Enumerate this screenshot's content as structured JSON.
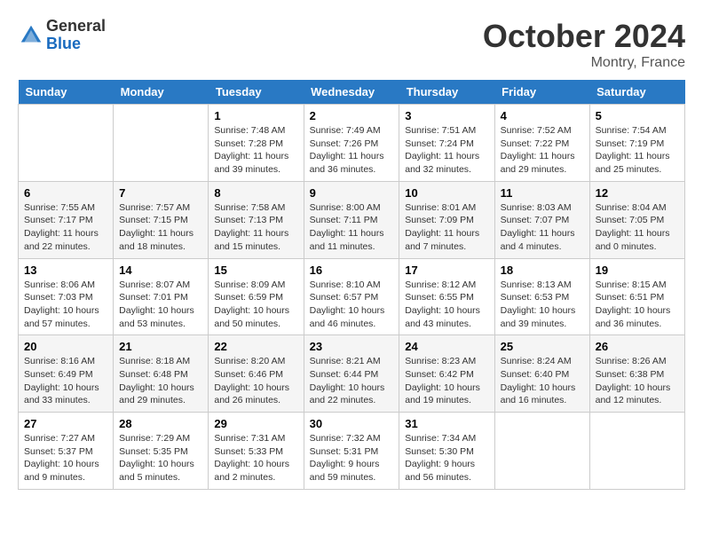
{
  "header": {
    "logo_general": "General",
    "logo_blue": "Blue",
    "month_title": "October 2024",
    "location": "Montry, France"
  },
  "weekdays": [
    "Sunday",
    "Monday",
    "Tuesday",
    "Wednesday",
    "Thursday",
    "Friday",
    "Saturday"
  ],
  "weeks": [
    [
      {
        "day": "",
        "info": ""
      },
      {
        "day": "",
        "info": ""
      },
      {
        "day": "1",
        "info": "Sunrise: 7:48 AM\nSunset: 7:28 PM\nDaylight: 11 hours and 39 minutes."
      },
      {
        "day": "2",
        "info": "Sunrise: 7:49 AM\nSunset: 7:26 PM\nDaylight: 11 hours and 36 minutes."
      },
      {
        "day": "3",
        "info": "Sunrise: 7:51 AM\nSunset: 7:24 PM\nDaylight: 11 hours and 32 minutes."
      },
      {
        "day": "4",
        "info": "Sunrise: 7:52 AM\nSunset: 7:22 PM\nDaylight: 11 hours and 29 minutes."
      },
      {
        "day": "5",
        "info": "Sunrise: 7:54 AM\nSunset: 7:19 PM\nDaylight: 11 hours and 25 minutes."
      }
    ],
    [
      {
        "day": "6",
        "info": "Sunrise: 7:55 AM\nSunset: 7:17 PM\nDaylight: 11 hours and 22 minutes."
      },
      {
        "day": "7",
        "info": "Sunrise: 7:57 AM\nSunset: 7:15 PM\nDaylight: 11 hours and 18 minutes."
      },
      {
        "day": "8",
        "info": "Sunrise: 7:58 AM\nSunset: 7:13 PM\nDaylight: 11 hours and 15 minutes."
      },
      {
        "day": "9",
        "info": "Sunrise: 8:00 AM\nSunset: 7:11 PM\nDaylight: 11 hours and 11 minutes."
      },
      {
        "day": "10",
        "info": "Sunrise: 8:01 AM\nSunset: 7:09 PM\nDaylight: 11 hours and 7 minutes."
      },
      {
        "day": "11",
        "info": "Sunrise: 8:03 AM\nSunset: 7:07 PM\nDaylight: 11 hours and 4 minutes."
      },
      {
        "day": "12",
        "info": "Sunrise: 8:04 AM\nSunset: 7:05 PM\nDaylight: 11 hours and 0 minutes."
      }
    ],
    [
      {
        "day": "13",
        "info": "Sunrise: 8:06 AM\nSunset: 7:03 PM\nDaylight: 10 hours and 57 minutes."
      },
      {
        "day": "14",
        "info": "Sunrise: 8:07 AM\nSunset: 7:01 PM\nDaylight: 10 hours and 53 minutes."
      },
      {
        "day": "15",
        "info": "Sunrise: 8:09 AM\nSunset: 6:59 PM\nDaylight: 10 hours and 50 minutes."
      },
      {
        "day": "16",
        "info": "Sunrise: 8:10 AM\nSunset: 6:57 PM\nDaylight: 10 hours and 46 minutes."
      },
      {
        "day": "17",
        "info": "Sunrise: 8:12 AM\nSunset: 6:55 PM\nDaylight: 10 hours and 43 minutes."
      },
      {
        "day": "18",
        "info": "Sunrise: 8:13 AM\nSunset: 6:53 PM\nDaylight: 10 hours and 39 minutes."
      },
      {
        "day": "19",
        "info": "Sunrise: 8:15 AM\nSunset: 6:51 PM\nDaylight: 10 hours and 36 minutes."
      }
    ],
    [
      {
        "day": "20",
        "info": "Sunrise: 8:16 AM\nSunset: 6:49 PM\nDaylight: 10 hours and 33 minutes."
      },
      {
        "day": "21",
        "info": "Sunrise: 8:18 AM\nSunset: 6:48 PM\nDaylight: 10 hours and 29 minutes."
      },
      {
        "day": "22",
        "info": "Sunrise: 8:20 AM\nSunset: 6:46 PM\nDaylight: 10 hours and 26 minutes."
      },
      {
        "day": "23",
        "info": "Sunrise: 8:21 AM\nSunset: 6:44 PM\nDaylight: 10 hours and 22 minutes."
      },
      {
        "day": "24",
        "info": "Sunrise: 8:23 AM\nSunset: 6:42 PM\nDaylight: 10 hours and 19 minutes."
      },
      {
        "day": "25",
        "info": "Sunrise: 8:24 AM\nSunset: 6:40 PM\nDaylight: 10 hours and 16 minutes."
      },
      {
        "day": "26",
        "info": "Sunrise: 8:26 AM\nSunset: 6:38 PM\nDaylight: 10 hours and 12 minutes."
      }
    ],
    [
      {
        "day": "27",
        "info": "Sunrise: 7:27 AM\nSunset: 5:37 PM\nDaylight: 10 hours and 9 minutes."
      },
      {
        "day": "28",
        "info": "Sunrise: 7:29 AM\nSunset: 5:35 PM\nDaylight: 10 hours and 5 minutes."
      },
      {
        "day": "29",
        "info": "Sunrise: 7:31 AM\nSunset: 5:33 PM\nDaylight: 10 hours and 2 minutes."
      },
      {
        "day": "30",
        "info": "Sunrise: 7:32 AM\nSunset: 5:31 PM\nDaylight: 9 hours and 59 minutes."
      },
      {
        "day": "31",
        "info": "Sunrise: 7:34 AM\nSunset: 5:30 PM\nDaylight: 9 hours and 56 minutes."
      },
      {
        "day": "",
        "info": ""
      },
      {
        "day": "",
        "info": ""
      }
    ]
  ]
}
